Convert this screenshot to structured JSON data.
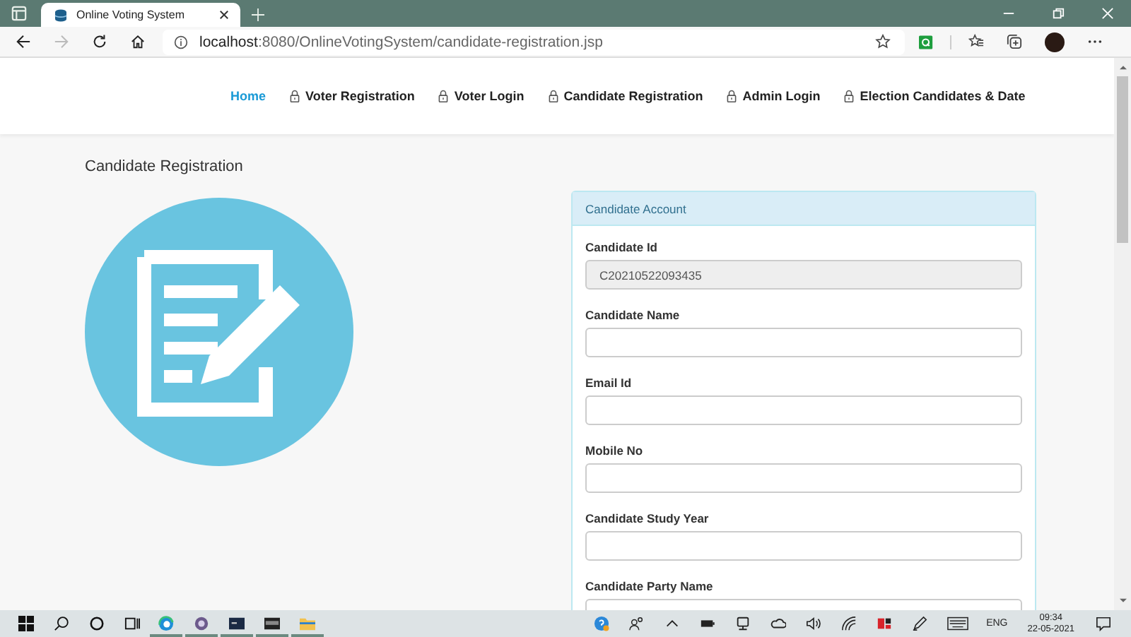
{
  "browser": {
    "tab_title": "Online Voting System",
    "url_host": "localhost",
    "url_path": ":8080/OnlineVotingSystem/candidate-registration.jsp"
  },
  "nav": [
    {
      "label": "Home",
      "selected": true,
      "locked": false
    },
    {
      "label": "Voter Registration",
      "selected": false,
      "locked": true
    },
    {
      "label": "Voter Login",
      "selected": false,
      "locked": true
    },
    {
      "label": "Candidate Registration",
      "selected": false,
      "locked": true
    },
    {
      "label": "Admin Login",
      "selected": false,
      "locked": true
    },
    {
      "label": "Election Candidates & Date",
      "selected": false,
      "locked": true
    }
  ],
  "page_title": "Candidate Registration",
  "panel": {
    "title": "Candidate Account",
    "fields": [
      {
        "label": "Candidate Id",
        "value": "C20210522093435",
        "disabled": true
      },
      {
        "label": "Candidate Name",
        "disabled": false
      },
      {
        "label": "Email Id",
        "disabled": false
      },
      {
        "label": "Mobile No",
        "disabled": false
      },
      {
        "label": "Candidate Study Year",
        "disabled": false
      },
      {
        "label": "Candidate Party Name",
        "disabled": false
      }
    ]
  },
  "taskbar": {
    "language": "ENG",
    "time": "09:34",
    "date": "22-05-2021"
  }
}
